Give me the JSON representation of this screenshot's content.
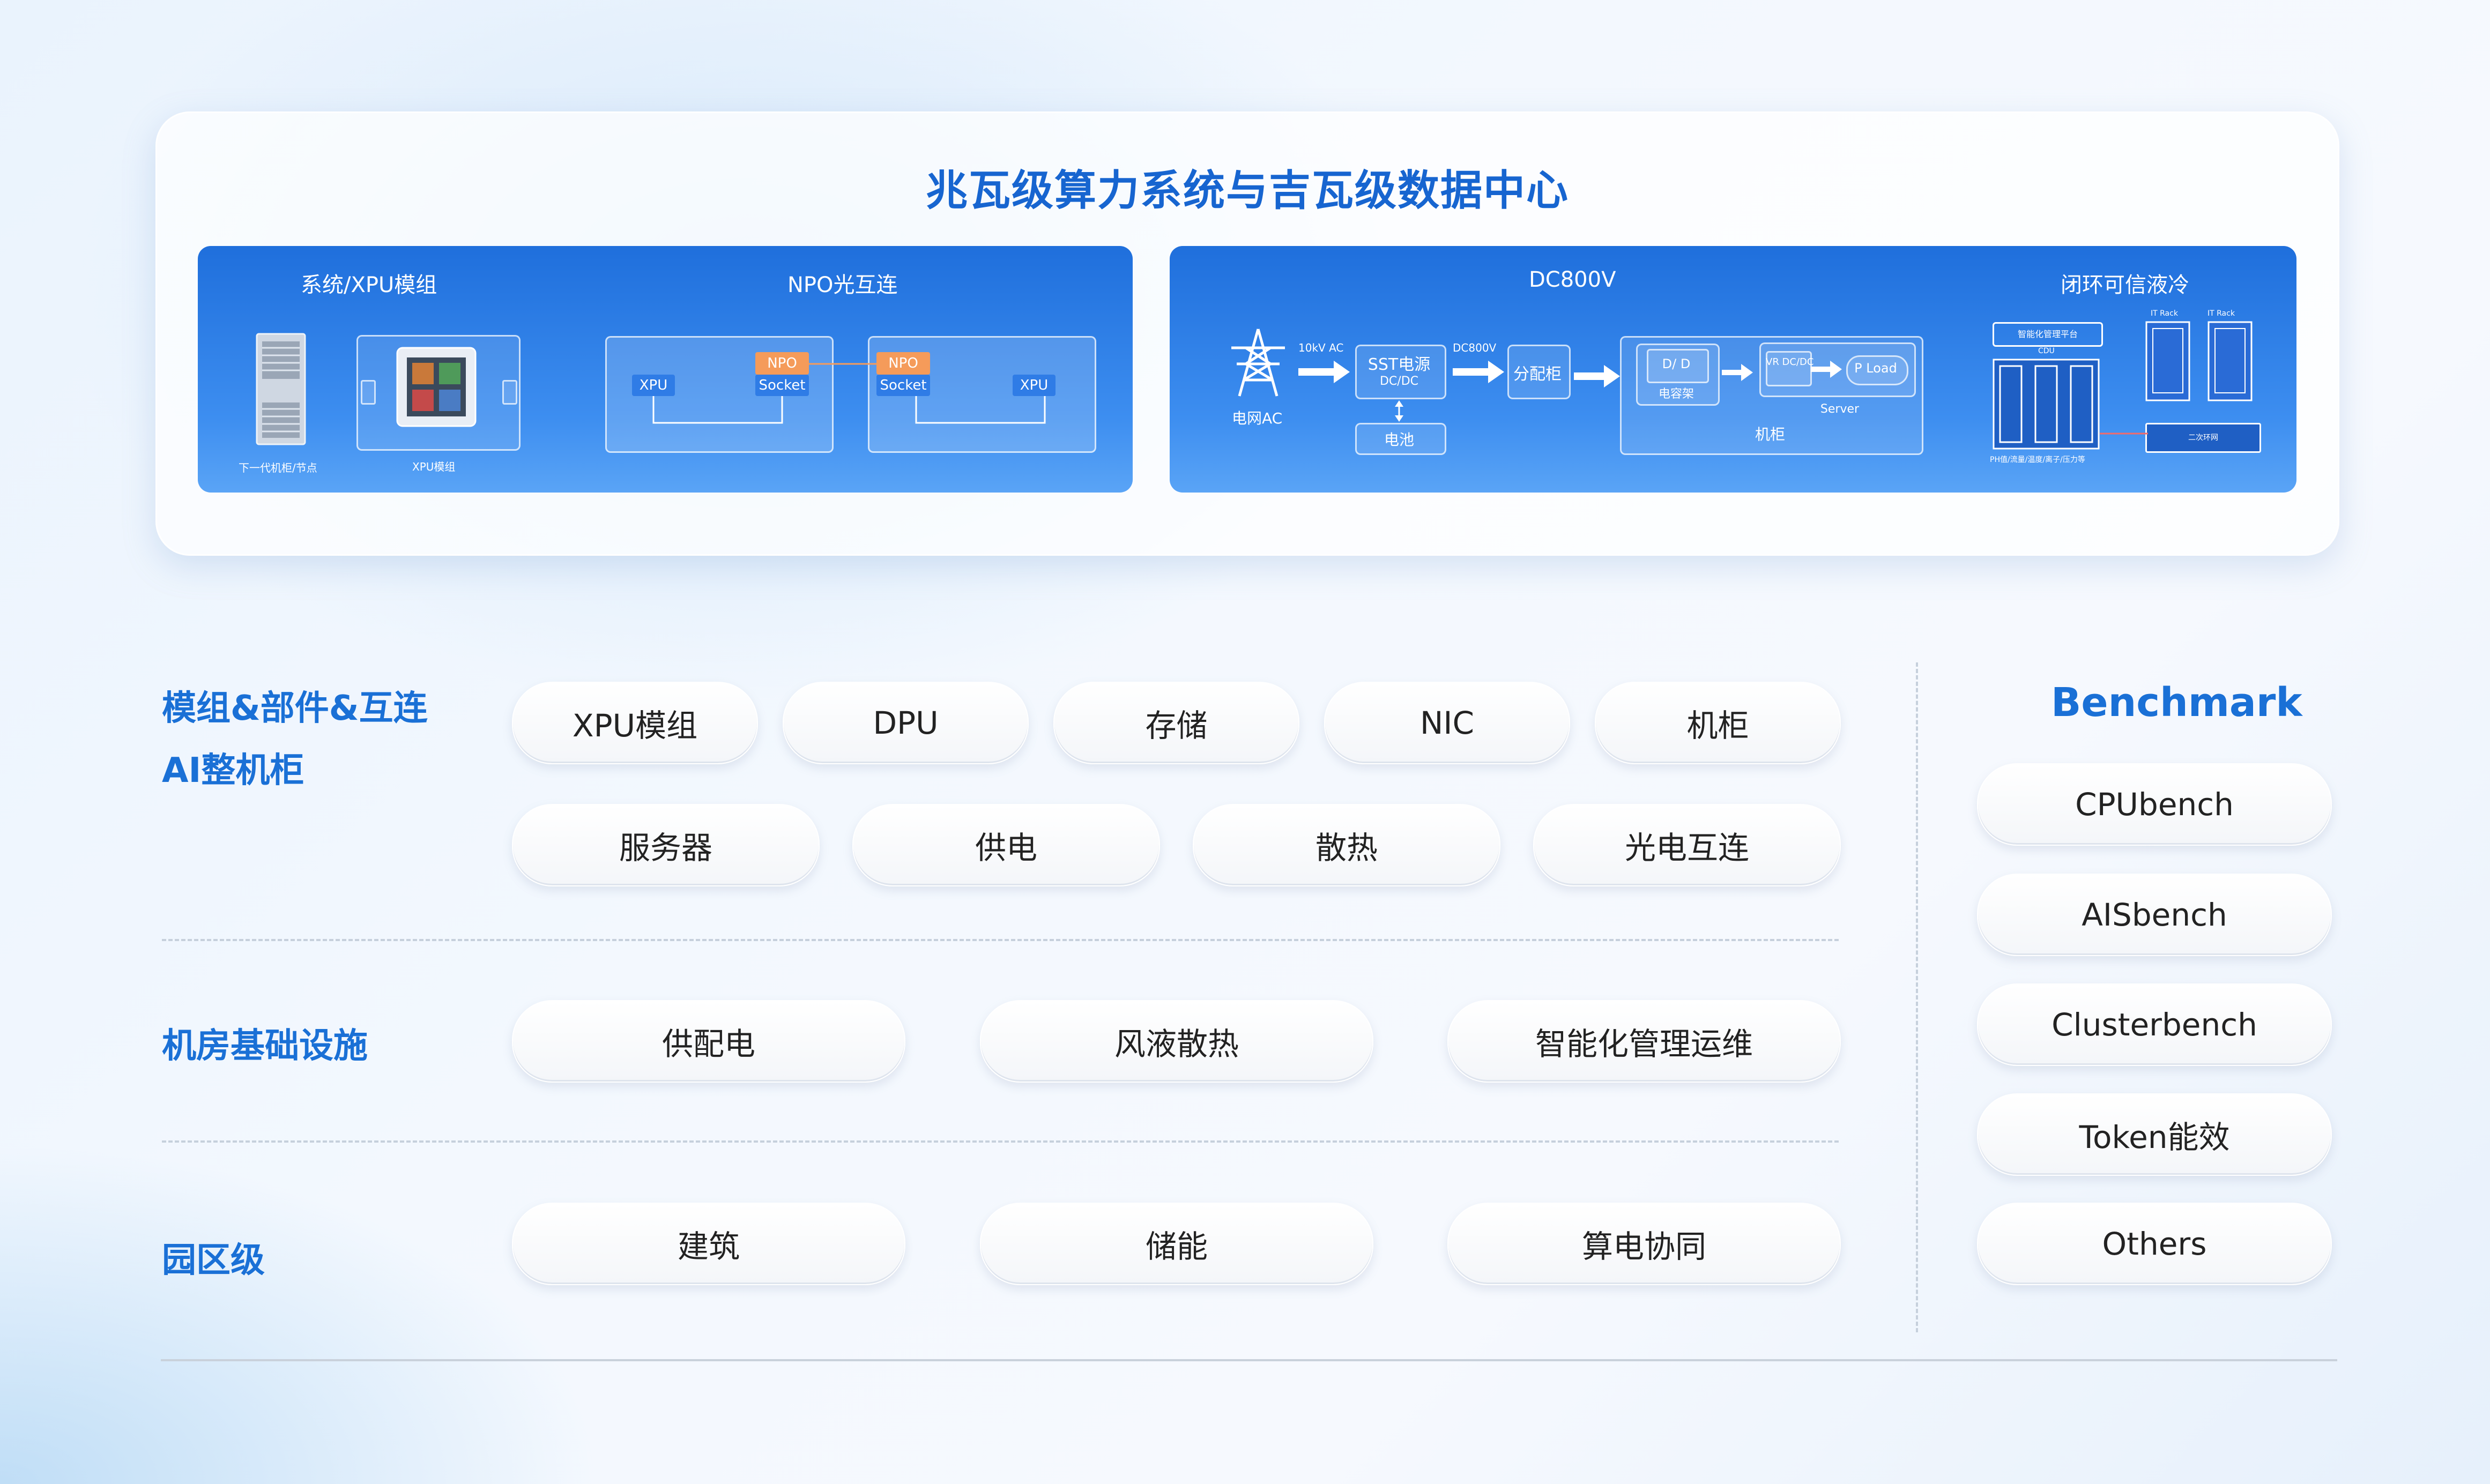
{
  "top": {
    "title": "兆瓦级算力系统与吉瓦级数据中心",
    "left_panel": {
      "sys_title": "系统/XPU模组",
      "npo_title": "NPO光互连",
      "rack_caption": "下一代机柜/节点",
      "module_caption": "XPU模组",
      "npo_left": {
        "xpu": "XPU",
        "npo": "NPO",
        "socket": "Socket"
      },
      "npo_right": {
        "xpu": "XPU",
        "npo": "NPO",
        "socket": "Socket"
      }
    },
    "right_panel": {
      "dc_title": "DC800V",
      "cooling_title": "闭环可信液冷",
      "grid_label": "电网AC",
      "ac_label": "10kV AC",
      "sst_label": "SST电源",
      "sst_sub": "DC/DC",
      "dc800_label": "DC800V",
      "battery_label": "电池",
      "dist_label": "分配柜",
      "dd_label": "D/ D",
      "cap_label": "电容架",
      "vr_label": "VR DC/DC",
      "pload_label": "P Load",
      "server_label": "Server",
      "cabinet_label": "机柜",
      "platform_label": "智能化管理平台",
      "cdu_label": "CDU",
      "it_rack_label": "IT Rack",
      "secondary_label": "二次环网",
      "sensor_caption": "PH值/流量/温度/离子/压力等"
    }
  },
  "sections": [
    {
      "label_lines": [
        "模组&部件&互连",
        "AI整机柜"
      ],
      "row1": [
        "XPU模组",
        "DPU",
        "存储",
        "NIC",
        "机柜"
      ],
      "row2": [
        "服务器",
        "供电",
        "散热",
        "光电互连"
      ]
    },
    {
      "label_lines": [
        "机房基础设施"
      ],
      "row1": [
        "供配电",
        "风液散热",
        "智能化管理运维"
      ]
    },
    {
      "label_lines": [
        "园区级"
      ],
      "row1": [
        "建筑",
        "储能",
        "算电协同"
      ]
    }
  ],
  "benchmark": {
    "title": "Benchmark",
    "items": [
      "CPUbench",
      "AISbench",
      "Clusterbench",
      "Token能效",
      "Others"
    ]
  }
}
